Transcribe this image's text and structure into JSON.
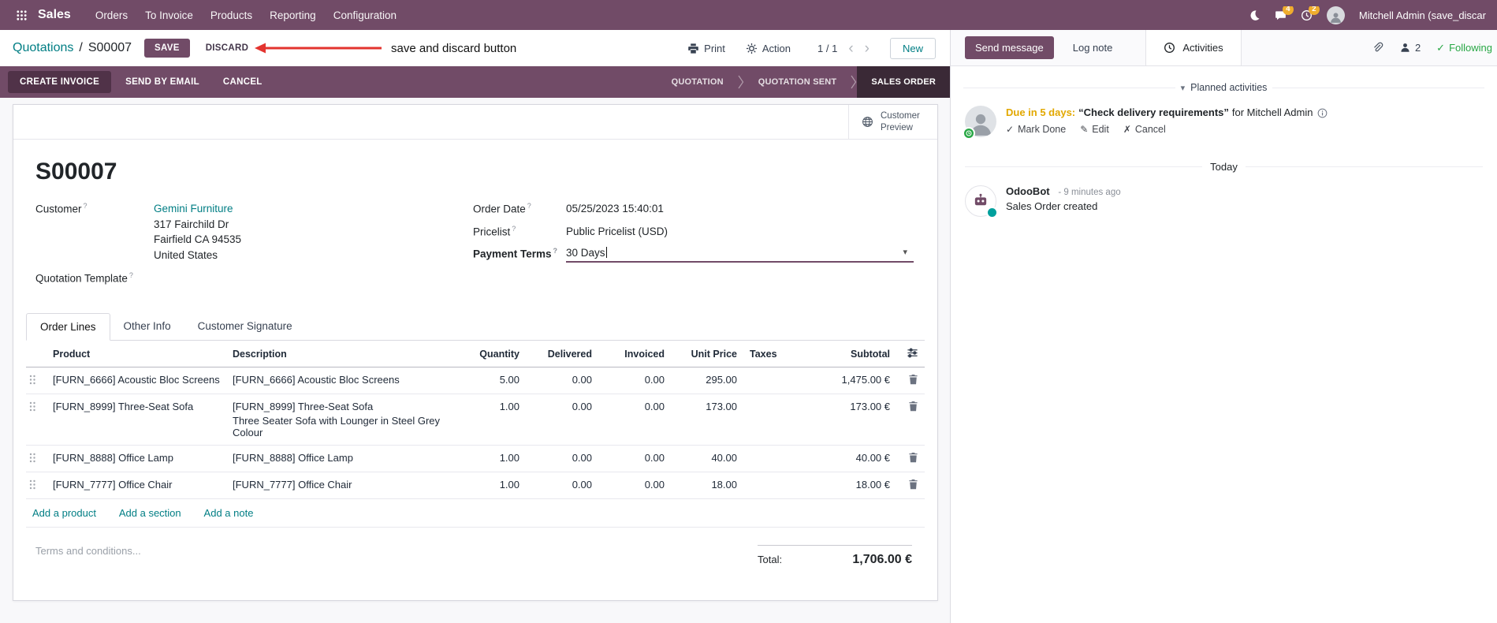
{
  "colors": {
    "brand": "#714B67",
    "link": "#017e84",
    "stage_active": "#3a2936",
    "modified_value": "#2a6fd6",
    "annotation_red": "#e3342f",
    "following_green": "#28a745",
    "due_amber": "#e2a800"
  },
  "icons": {
    "caret_down": "▾",
    "check": "✓",
    "pencil": "✎",
    "cross": "✗",
    "pager_prev": "‹",
    "pager_next": "›",
    "help": "?",
    "separator": "/"
  },
  "topbar": {
    "app_name": "Sales",
    "menus": [
      "Orders",
      "To Invoice",
      "Products",
      "Reporting",
      "Configuration"
    ],
    "messages_badge": "4",
    "activities_badge": "2",
    "user_name": "Mitchell Admin (save_discar"
  },
  "breadcrumb": {
    "parent": "Quotations",
    "current": "S00007",
    "save": "SAVE",
    "discard": "DISCARD",
    "print": "Print",
    "action": "Action",
    "pager": "1 / 1",
    "new": "New"
  },
  "annotation": {
    "text": "save and discard button"
  },
  "statusbar": {
    "buttons": [
      "CREATE INVOICE",
      "SEND BY EMAIL",
      "CANCEL"
    ],
    "stages": [
      "QUOTATION",
      "QUOTATION SENT",
      "SALES ORDER"
    ],
    "active_stage_index": 2
  },
  "form": {
    "customer_preview": "Customer Preview",
    "title": "S00007",
    "customer_label": "Customer",
    "customer_name": "Gemini Furniture",
    "customer_address": [
      "317 Fairchild Dr",
      "Fairfield CA 94535",
      "United States"
    ],
    "quotation_template_label": "Quotation Template",
    "order_date_label": "Order Date",
    "order_date": "05/25/2023 15:40:01",
    "pricelist_label": "Pricelist",
    "pricelist": "Public Pricelist (USD)",
    "payment_terms_label": "Payment Terms",
    "payment_terms": "30 Days",
    "tabs": [
      "Order Lines",
      "Other Info",
      "Customer Signature"
    ],
    "table": {
      "headers": [
        "Product",
        "Description",
        "Quantity",
        "Delivered",
        "Invoiced",
        "Unit Price",
        "Taxes",
        "Subtotal"
      ],
      "rows": [
        {
          "product": "[FURN_6666] Acoustic Bloc Screens",
          "description": "[FURN_6666] Acoustic Bloc Screens",
          "description2": "",
          "quantity": "5.00",
          "delivered": "0.00",
          "invoiced": "0.00",
          "unit_price": "295.00",
          "taxes": "",
          "subtotal": "1,475.00 €"
        },
        {
          "product": "[FURN_8999] Three-Seat Sofa",
          "description": "[FURN_8999] Three-Seat Sofa",
          "description2": "Three Seater Sofa with Lounger in Steel Grey Colour",
          "quantity": "1.00",
          "delivered": "0.00",
          "invoiced": "0.00",
          "unit_price": "173.00",
          "taxes": "",
          "subtotal": "173.00 €"
        },
        {
          "product": "[FURN_8888] Office Lamp",
          "description": "[FURN_8888] Office Lamp",
          "description2": "",
          "quantity": "1.00",
          "delivered": "0.00",
          "invoiced": "0.00",
          "unit_price": "40.00",
          "taxes": "",
          "subtotal": "40.00 €"
        },
        {
          "product": "[FURN_7777] Office Chair",
          "description": "[FURN_7777] Office Chair",
          "description2": "",
          "quantity": "1.00",
          "delivered": "0.00",
          "invoiced": "0.00",
          "unit_price": "18.00",
          "taxes": "",
          "subtotal": "18.00 €"
        }
      ]
    },
    "links": [
      "Add a product",
      "Add a section",
      "Add a note"
    ],
    "terms_placeholder": "Terms and conditions...",
    "total_label": "Total:",
    "total_value": "1,706.00 €"
  },
  "chatter": {
    "send_message": "Send message",
    "log_note": "Log note",
    "activities": "Activities",
    "followers_count": "2",
    "following": "Following",
    "planned_title": "Planned activities",
    "activity": {
      "due": "Due in 5 days:",
      "summary": "“Check delivery requirements”",
      "assignee": "for Mitchell Admin",
      "mark_done": "Mark Done",
      "edit": "Edit",
      "cancel": "Cancel"
    },
    "today": "Today",
    "message": {
      "author": "OdooBot",
      "time": "- 9 minutes ago",
      "body": "Sales Order created"
    }
  }
}
